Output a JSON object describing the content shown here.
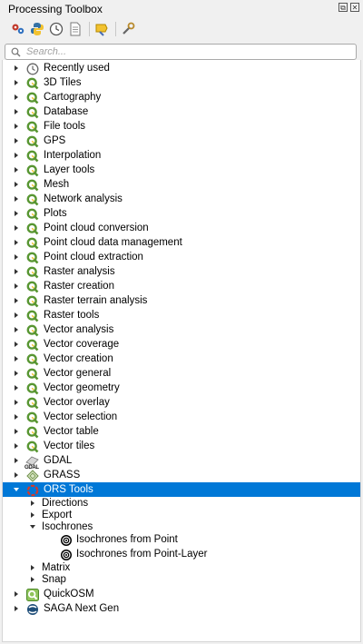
{
  "panel": {
    "title": "Processing Toolbox"
  },
  "toolbar": {
    "tools": [
      "models-icon",
      "python-icon",
      "history-icon",
      "results-icon",
      "edit-features-icon",
      "options-icon"
    ]
  },
  "search": {
    "placeholder": "Search..."
  },
  "tree": {
    "providers": [
      {
        "label": "Recently used",
        "icon": "clock-icon"
      },
      {
        "label": "3D Tiles",
        "icon": "qgis-icon"
      },
      {
        "label": "Cartography",
        "icon": "qgis-icon"
      },
      {
        "label": "Database",
        "icon": "qgis-icon"
      },
      {
        "label": "File tools",
        "icon": "qgis-icon"
      },
      {
        "label": "GPS",
        "icon": "qgis-icon"
      },
      {
        "label": "Interpolation",
        "icon": "qgis-icon"
      },
      {
        "label": "Layer tools",
        "icon": "qgis-icon"
      },
      {
        "label": "Mesh",
        "icon": "qgis-icon"
      },
      {
        "label": "Network analysis",
        "icon": "qgis-icon"
      },
      {
        "label": "Plots",
        "icon": "qgis-icon"
      },
      {
        "label": "Point cloud conversion",
        "icon": "qgis-icon"
      },
      {
        "label": "Point cloud data management",
        "icon": "qgis-icon"
      },
      {
        "label": "Point cloud extraction",
        "icon": "qgis-icon"
      },
      {
        "label": "Raster analysis",
        "icon": "qgis-icon"
      },
      {
        "label": "Raster creation",
        "icon": "qgis-icon"
      },
      {
        "label": "Raster terrain analysis",
        "icon": "qgis-icon"
      },
      {
        "label": "Raster tools",
        "icon": "qgis-icon"
      },
      {
        "label": "Vector analysis",
        "icon": "qgis-icon"
      },
      {
        "label": "Vector coverage",
        "icon": "qgis-icon"
      },
      {
        "label": "Vector creation",
        "icon": "qgis-icon"
      },
      {
        "label": "Vector general",
        "icon": "qgis-icon"
      },
      {
        "label": "Vector geometry",
        "icon": "qgis-icon"
      },
      {
        "label": "Vector overlay",
        "icon": "qgis-icon"
      },
      {
        "label": "Vector selection",
        "icon": "qgis-icon"
      },
      {
        "label": "Vector table",
        "icon": "qgis-icon"
      },
      {
        "label": "Vector tiles",
        "icon": "qgis-icon"
      },
      {
        "label": "GDAL",
        "icon": "gdal-icon",
        "icon_text": "GDAL"
      },
      {
        "label": "GRASS",
        "icon": "grass-icon"
      },
      {
        "label": "ORS Tools",
        "icon": "ors-icon",
        "expanded": true,
        "selected": true
      },
      {
        "label": "QuickOSM",
        "icon": "quickosm-icon"
      },
      {
        "label": "SAGA Next Gen",
        "icon": "saga-icon"
      }
    ],
    "ors_children": [
      {
        "label": "Directions",
        "expanded": false
      },
      {
        "label": "Export",
        "expanded": false
      },
      {
        "label": "Isochrones",
        "expanded": true,
        "children": [
          {
            "label": "Isochrones from Point",
            "icon": "isochrone-icon"
          },
          {
            "label": "Isochrones from Point-Layer",
            "icon": "isochrone-icon"
          }
        ]
      },
      {
        "label": "Matrix",
        "expanded": false
      },
      {
        "label": "Snap",
        "expanded": false
      }
    ]
  },
  "colors": {
    "qgis_green": "#589632",
    "selection": "#0078d7",
    "ors_red": "#c0392b"
  }
}
